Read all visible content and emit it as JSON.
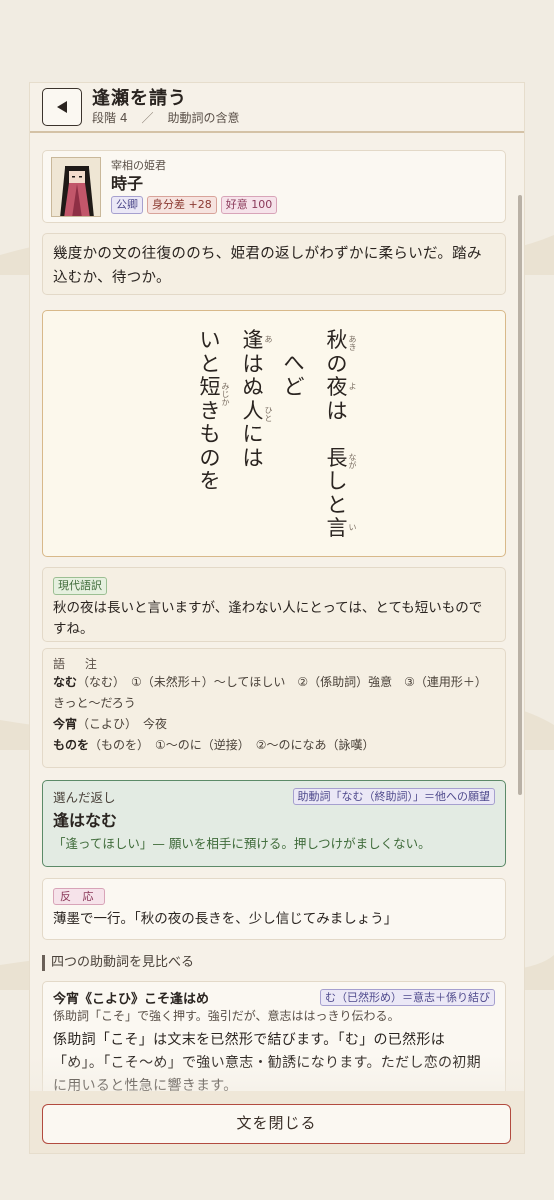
{
  "header": {
    "back_icon": "left-triangle-icon",
    "title": "逢瀬を請う",
    "stage": "段階 4",
    "separator": "／",
    "topic": "助動詞の含意"
  },
  "character": {
    "role": "宰相の姫君",
    "name": "時子",
    "tags": [
      "公卿",
      "身分差 +28",
      "好意 100"
    ]
  },
  "narration": "幾度かの文の往復ののち、姫君の返しがわずかに柔らいだ。踏み込むか、待つか。",
  "poem": {
    "columns": [
      [
        {
          "c": "秋",
          "r": "あき"
        },
        {
          "c": "の"
        },
        {
          "c": "夜",
          "r": "よ"
        },
        {
          "c": "は"
        },
        {
          "c": "　"
        },
        {
          "c": "長",
          "r": "なが"
        },
        {
          "c": "し"
        },
        {
          "c": "と"
        },
        {
          "c": "言",
          "r": "い"
        }
      ],
      [
        {
          "c": "へ"
        },
        {
          "c": "ど"
        }
      ],
      [
        {
          "c": "逢",
          "r": "あ"
        },
        {
          "c": "は"
        },
        {
          "c": "ぬ"
        },
        {
          "c": "人",
          "r": "ひと"
        },
        {
          "c": "に"
        },
        {
          "c": "は"
        }
      ],
      [
        {
          "c": "い"
        },
        {
          "c": "と"
        },
        {
          "c": "短",
          "r": "みじか"
        },
        {
          "c": "き"
        },
        {
          "c": "も"
        },
        {
          "c": "の"
        },
        {
          "c": "を"
        }
      ]
    ]
  },
  "translation": {
    "label": "現代語訳",
    "text": "秋の夜は長いと言いますが、逢わない人にとっては、とても短いものですね。"
  },
  "glossary": {
    "heading": "語 注",
    "rows": [
      {
        "term": "なむ",
        "text": "（なむ）　①（未然形＋）〜してほしい　②（係助詞）強意　③（連用形＋）きっと〜だろう"
      },
      {
        "term": "今宵",
        "text": "（こよひ）　今夜"
      },
      {
        "term": "ものを",
        "text": "（ものを）　①〜のに（逆接）　②〜のになあ（詠嘆）"
      }
    ]
  },
  "choice": {
    "label": "選んだ返し",
    "tag": "助動詞「なむ（終助詞）」＝他への願望",
    "text": "逢はなむ",
    "desc": "「逢ってほしい」— 願いを相手に預ける。押しつけがましくない。"
  },
  "reaction": {
    "label": "反 応",
    "text": "薄墨で一行。「秋の夜の長きを、少し信じてみましょう」"
  },
  "compare": {
    "section_title": "四つの助動詞を見比べる",
    "title": "今宵《こよひ》こそ逢はめ",
    "tag": "む（已然形め）＝意志＋係り結び",
    "sub": "係助詞「こそ」で強く押す。強引だが、意志ははっきり伝わる。",
    "body": "係助詞「こそ」は文末を已然形で結びます。「む」の已然形は「め」。「こそ〜め」で強い意志・勧誘になります。ただし恋の初期に用いると性急に響きます。"
  },
  "close_button": "文を閉じる"
}
